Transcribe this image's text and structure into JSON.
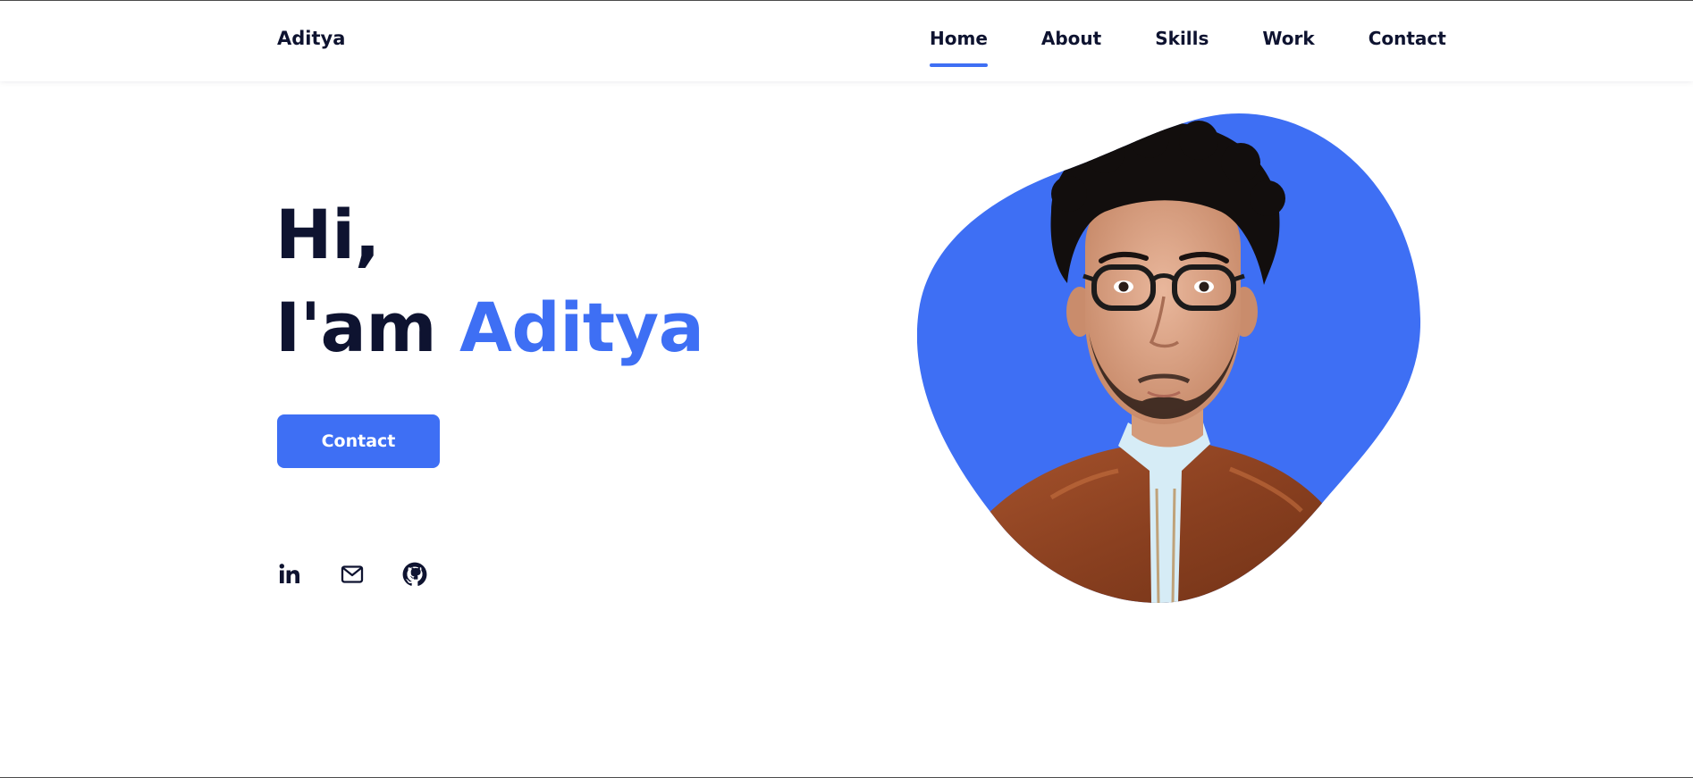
{
  "header": {
    "logo": "Aditya",
    "nav": [
      {
        "label": "Home",
        "active": true
      },
      {
        "label": "About",
        "active": false
      },
      {
        "label": "Skills",
        "active": false
      },
      {
        "label": "Work",
        "active": false
      },
      {
        "label": "Contact",
        "active": false
      }
    ]
  },
  "hero": {
    "greeting": "Hi,",
    "intro": "I'am",
    "name": "Aditya",
    "contact_button": "Contact",
    "socials": [
      {
        "icon": "linkedin-icon"
      },
      {
        "icon": "mail-icon"
      },
      {
        "icon": "github-icon"
      }
    ],
    "photo_icon": "profile-photo"
  },
  "colors": {
    "accent": "#3e6ff4",
    "text": "#0e1330",
    "background": "#ffffff"
  }
}
